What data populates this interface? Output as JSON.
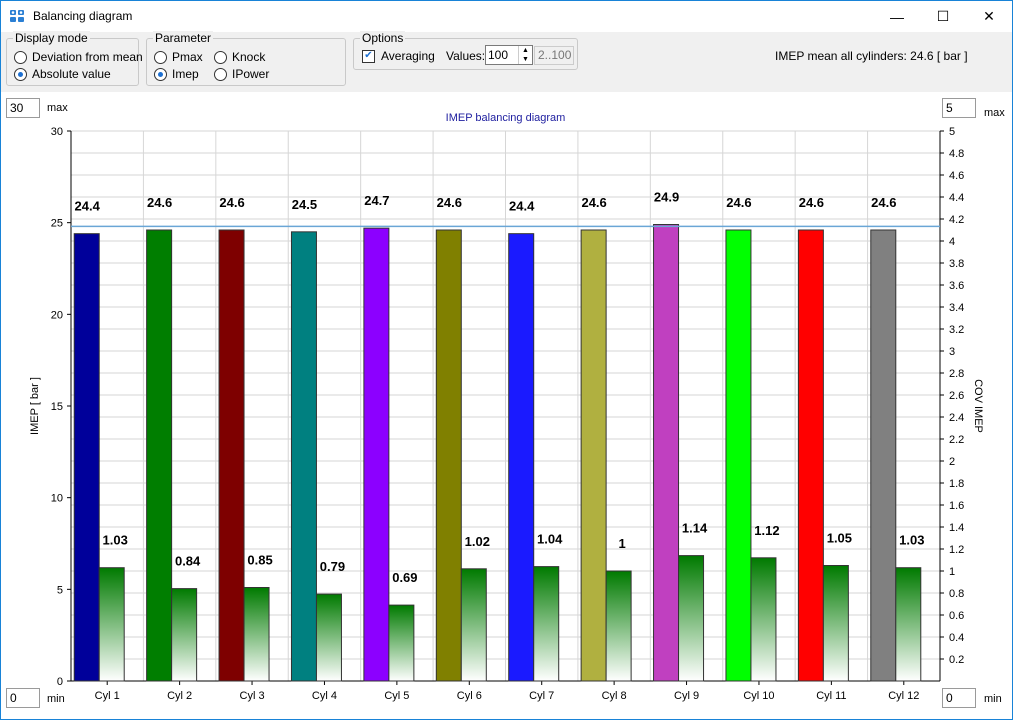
{
  "window": {
    "title": "Balancing diagram",
    "minimize": "—",
    "maximize": "☐",
    "close": "✕"
  },
  "display_mode": {
    "legend": "Display mode",
    "options": [
      {
        "label": "Deviation from mean",
        "selected": false
      },
      {
        "label": "Absolute value",
        "selected": true
      }
    ]
  },
  "parameter": {
    "legend": "Parameter",
    "options": [
      {
        "label": "Pmax",
        "selected": false
      },
      {
        "label": "Knock",
        "selected": false
      },
      {
        "label": "Imep",
        "selected": true
      },
      {
        "label": "IPower",
        "selected": false
      }
    ]
  },
  "options": {
    "legend": "Options",
    "averaging_label": "Averaging",
    "averaging_checked": true,
    "values_label": "Values:",
    "values_value": "100",
    "range_text": "2..100"
  },
  "summary": "IMEP mean all cylinders: 24.6 [ bar ]",
  "axis_controls": {
    "left_max": "30",
    "left_max_label": "max",
    "left_min": "0",
    "left_min_label": "min",
    "right_max": "5",
    "right_max_label": "max",
    "right_min": "0",
    "right_min_label": "min"
  },
  "chart_data": {
    "type": "bar",
    "title": "IMEP balancing diagram",
    "ylabel": "IMEP [ bar ]",
    "y2label": "COV IMEP",
    "ylim": [
      0,
      30
    ],
    "y2lim": [
      0,
      5
    ],
    "yticks": [
      0,
      5,
      10,
      15,
      20,
      25,
      30
    ],
    "y2ticks": [
      "0.2",
      "0.4",
      "0.6",
      "0.8",
      "1",
      "1.2",
      "1.4",
      "1.6",
      "1.8",
      "2",
      "2.2",
      "2.4",
      "2.6",
      "2.8",
      "3",
      "3.2",
      "3.4",
      "3.6",
      "3.8",
      "4",
      "4.2",
      "4.4",
      "4.6",
      "4.8",
      "5"
    ],
    "categories": [
      "Cyl 1",
      "Cyl 2",
      "Cyl 3",
      "Cyl 4",
      "Cyl 5",
      "Cyl 6",
      "Cyl 7",
      "Cyl 8",
      "Cyl 9",
      "Cyl 10",
      "Cyl 11",
      "Cyl 12"
    ],
    "imep_values": [
      24.4,
      24.6,
      24.6,
      24.5,
      24.7,
      24.6,
      24.4,
      24.6,
      24.9,
      24.6,
      24.6,
      24.6
    ],
    "imep_labels": [
      "24.4",
      "24.6",
      "24.6",
      "24.5",
      "24.7",
      "24.6",
      "24.4",
      "24.6",
      "24.9",
      "24.6",
      "24.6",
      "24.6"
    ],
    "cov_values": [
      1.03,
      0.84,
      0.85,
      0.79,
      0.69,
      1.02,
      1.04,
      1,
      1.14,
      1.12,
      1.05,
      1.03
    ],
    "cov_labels": [
      "1.03",
      "0.84",
      "0.85",
      "0.79",
      "0.69",
      "1.02",
      "1.04",
      "1",
      "1.14",
      "1.12",
      "1.05",
      "1.03"
    ],
    "bar_colors": [
      "#00009a",
      "#007e00",
      "#7e0000",
      "#008080",
      "#8c00ff",
      "#808000",
      "#1a1aff",
      "#b0b040",
      "#c040c0",
      "#00ff00",
      "#ff0000",
      "#808080"
    ],
    "mean_line": 24.8,
    "mean_line_color": "#6aa6d6",
    "cov_gradient": [
      "#007a00",
      "#ffffff"
    ],
    "grid": true
  }
}
